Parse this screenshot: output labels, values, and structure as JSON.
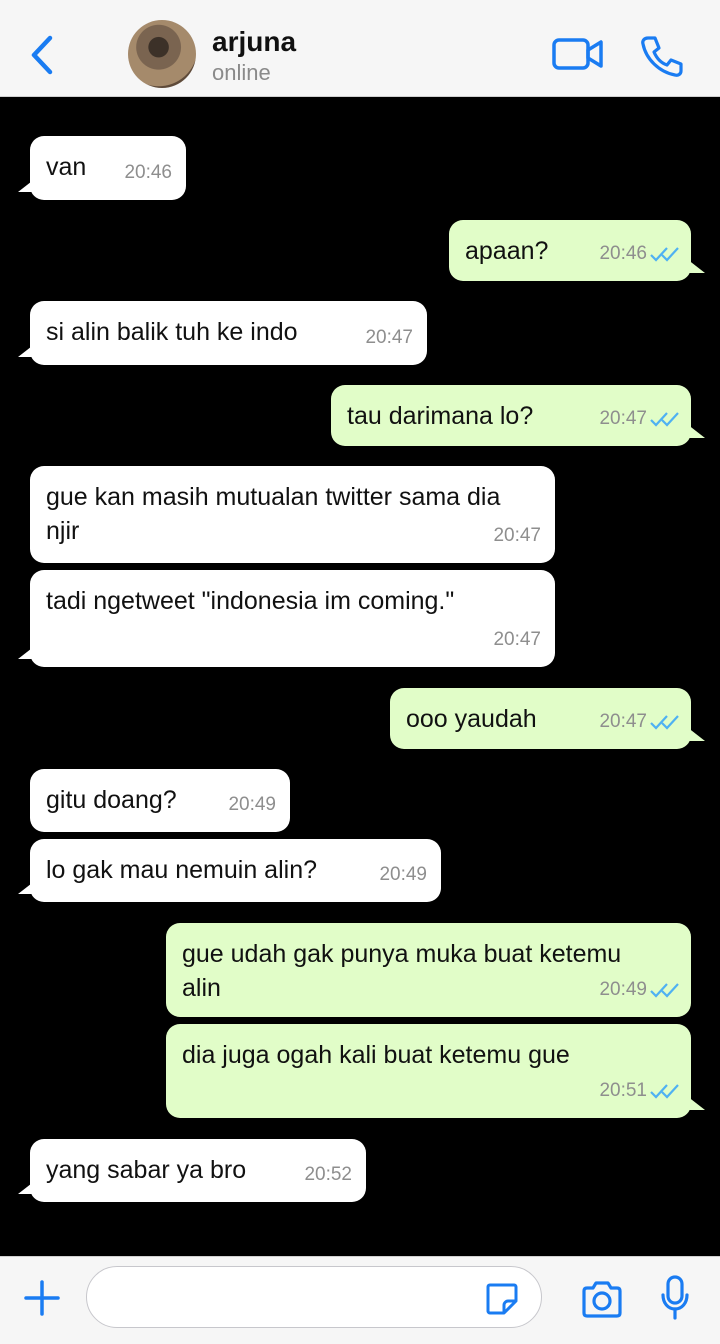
{
  "header": {
    "back_icon": "chevron-left-icon",
    "contact_name": "arjuna",
    "contact_status": "online",
    "video_icon": "video-camera-icon",
    "call_icon": "phone-icon"
  },
  "colors": {
    "accent": "#1a7cf2",
    "incoming_bubble": "#ffffff",
    "outgoing_bubble": "#e1fdc8",
    "read_ticks": "#4fb1f2",
    "chat_background": "#000000"
  },
  "messages": [
    {
      "direction": "in",
      "text": "van",
      "time": "20:46"
    },
    {
      "direction": "out",
      "text": "apaan?",
      "time": "20:46",
      "status": "read"
    },
    {
      "direction": "in",
      "text": "si alin balik tuh ke indo",
      "time": "20:47"
    },
    {
      "direction": "out",
      "text": "tau darimana lo?",
      "time": "20:47",
      "status": "read"
    },
    {
      "direction": "in",
      "text": "gue kan masih mutualan twitter sama dia njir",
      "time": "20:47"
    },
    {
      "direction": "in",
      "text": "tadi ngetweet \"indonesia im coming.\"",
      "time": "20:47"
    },
    {
      "direction": "out",
      "text": "ooo yaudah",
      "time": "20:47",
      "status": "read"
    },
    {
      "direction": "in",
      "text": "gitu doang?",
      "time": "20:49"
    },
    {
      "direction": "in",
      "text": "lo gak mau nemuin alin?",
      "time": "20:49"
    },
    {
      "direction": "out",
      "text": "gue udah gak punya muka buat ketemu alin",
      "time": "20:49",
      "status": "read"
    },
    {
      "direction": "out",
      "text": "dia juga ogah kali buat ketemu gue",
      "time": "20:51",
      "status": "read"
    },
    {
      "direction": "in",
      "text": "yang sabar ya bro",
      "time": "20:52"
    }
  ],
  "input_bar": {
    "plus_icon": "plus-icon",
    "placeholder": "",
    "sticker_icon": "sticker-icon",
    "camera_icon": "camera-icon",
    "mic_icon": "microphone-icon"
  }
}
